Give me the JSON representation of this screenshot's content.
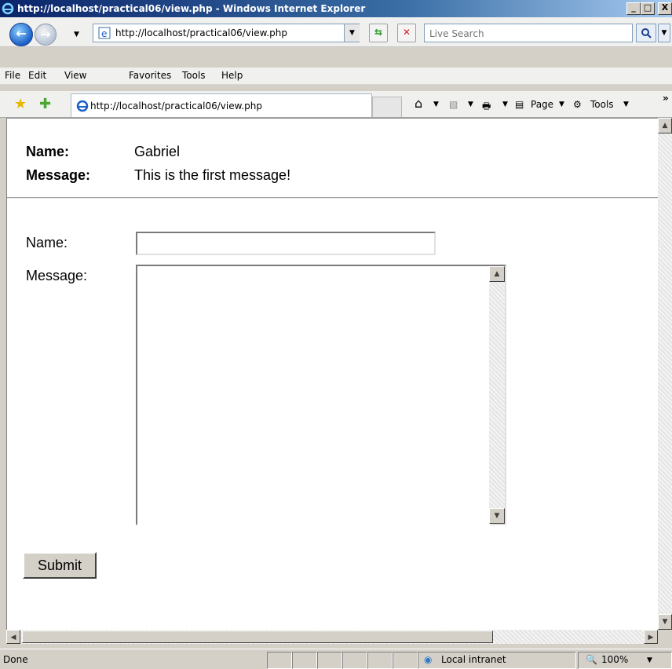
{
  "window": {
    "title": "http://localhost/practical06/view.php - Windows Internet Explorer",
    "min_label": "_",
    "max_label": "□",
    "close_label": "X"
  },
  "address": {
    "url": "http://localhost/practical06/view.php",
    "refresh_glyph": "⇆",
    "stop_glyph": "✕"
  },
  "search": {
    "placeholder": "Live Search"
  },
  "menu": {
    "items": [
      "File",
      "Edit",
      "View",
      "Favorites",
      "Tools",
      "Help"
    ]
  },
  "favorites_tab": {
    "title": "http://localhost/practical06/view.php"
  },
  "command_bar": {
    "page_label": "Page",
    "tools_label": "Tools",
    "more_label": "»"
  },
  "message": {
    "name_label": "Name:",
    "name_value": "Gabriel",
    "message_label": "Message:",
    "message_value": "This is the first message!"
  },
  "form": {
    "name_label": "Name:",
    "name_value": "",
    "message_label": "Message:",
    "message_value": "",
    "submit_label": "Submit"
  },
  "status_bar": {
    "text": "Done",
    "zone": "Local intranet",
    "zoom": "100%"
  }
}
